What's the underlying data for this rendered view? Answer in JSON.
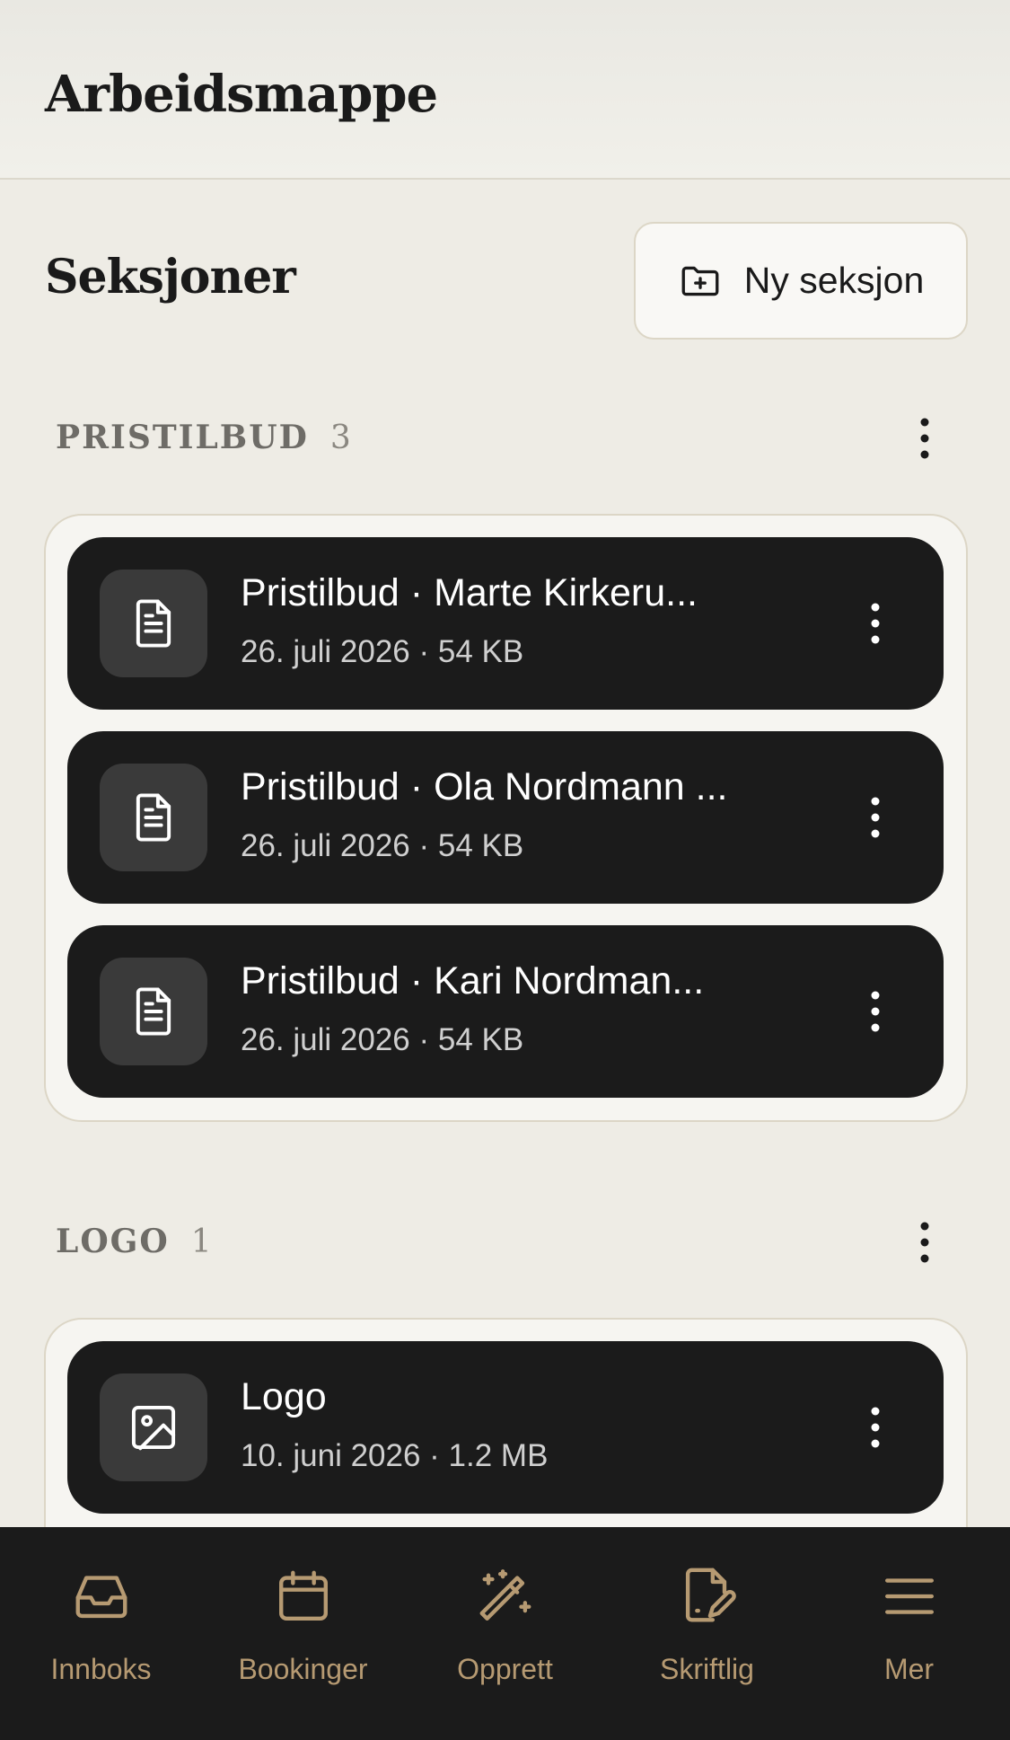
{
  "header": {
    "title": "Arbeidsmappe"
  },
  "sections_header": {
    "title": "Seksjoner",
    "new_section_label": "Ny seksjon"
  },
  "sections": [
    {
      "name": "PRISTILBUD",
      "count": "3",
      "files": [
        {
          "title": "Pristilbud · Marte Kirkeru...",
          "meta": "26. juli 2026 · 54 KB",
          "icon": "document-icon"
        },
        {
          "title": "Pristilbud · Ola Nordmann ...",
          "meta": "26. juli 2026 · 54 KB",
          "icon": "document-icon"
        },
        {
          "title": "Pristilbud · Kari Nordman...",
          "meta": "26. juli 2026 · 54 KB",
          "icon": "document-icon"
        }
      ]
    },
    {
      "name": "LOGO",
      "count": "1",
      "files": [
        {
          "title": "Logo",
          "meta": "10. juni 2026 · 1.2 MB",
          "icon": "image-icon"
        }
      ]
    }
  ],
  "nav": {
    "items": [
      {
        "label": "Innboks",
        "icon": "inbox-icon"
      },
      {
        "label": "Bookinger",
        "icon": "calendar-icon"
      },
      {
        "label": "Opprett",
        "icon": "magic-wand-icon"
      },
      {
        "label": "Skriftlig",
        "icon": "document-sign-icon"
      },
      {
        "label": "Mer",
        "icon": "menu-icon"
      }
    ]
  },
  "colors": {
    "background": "#eeece5",
    "card_dark": "#1b1b1b",
    "nav_accent": "#b69a72"
  }
}
